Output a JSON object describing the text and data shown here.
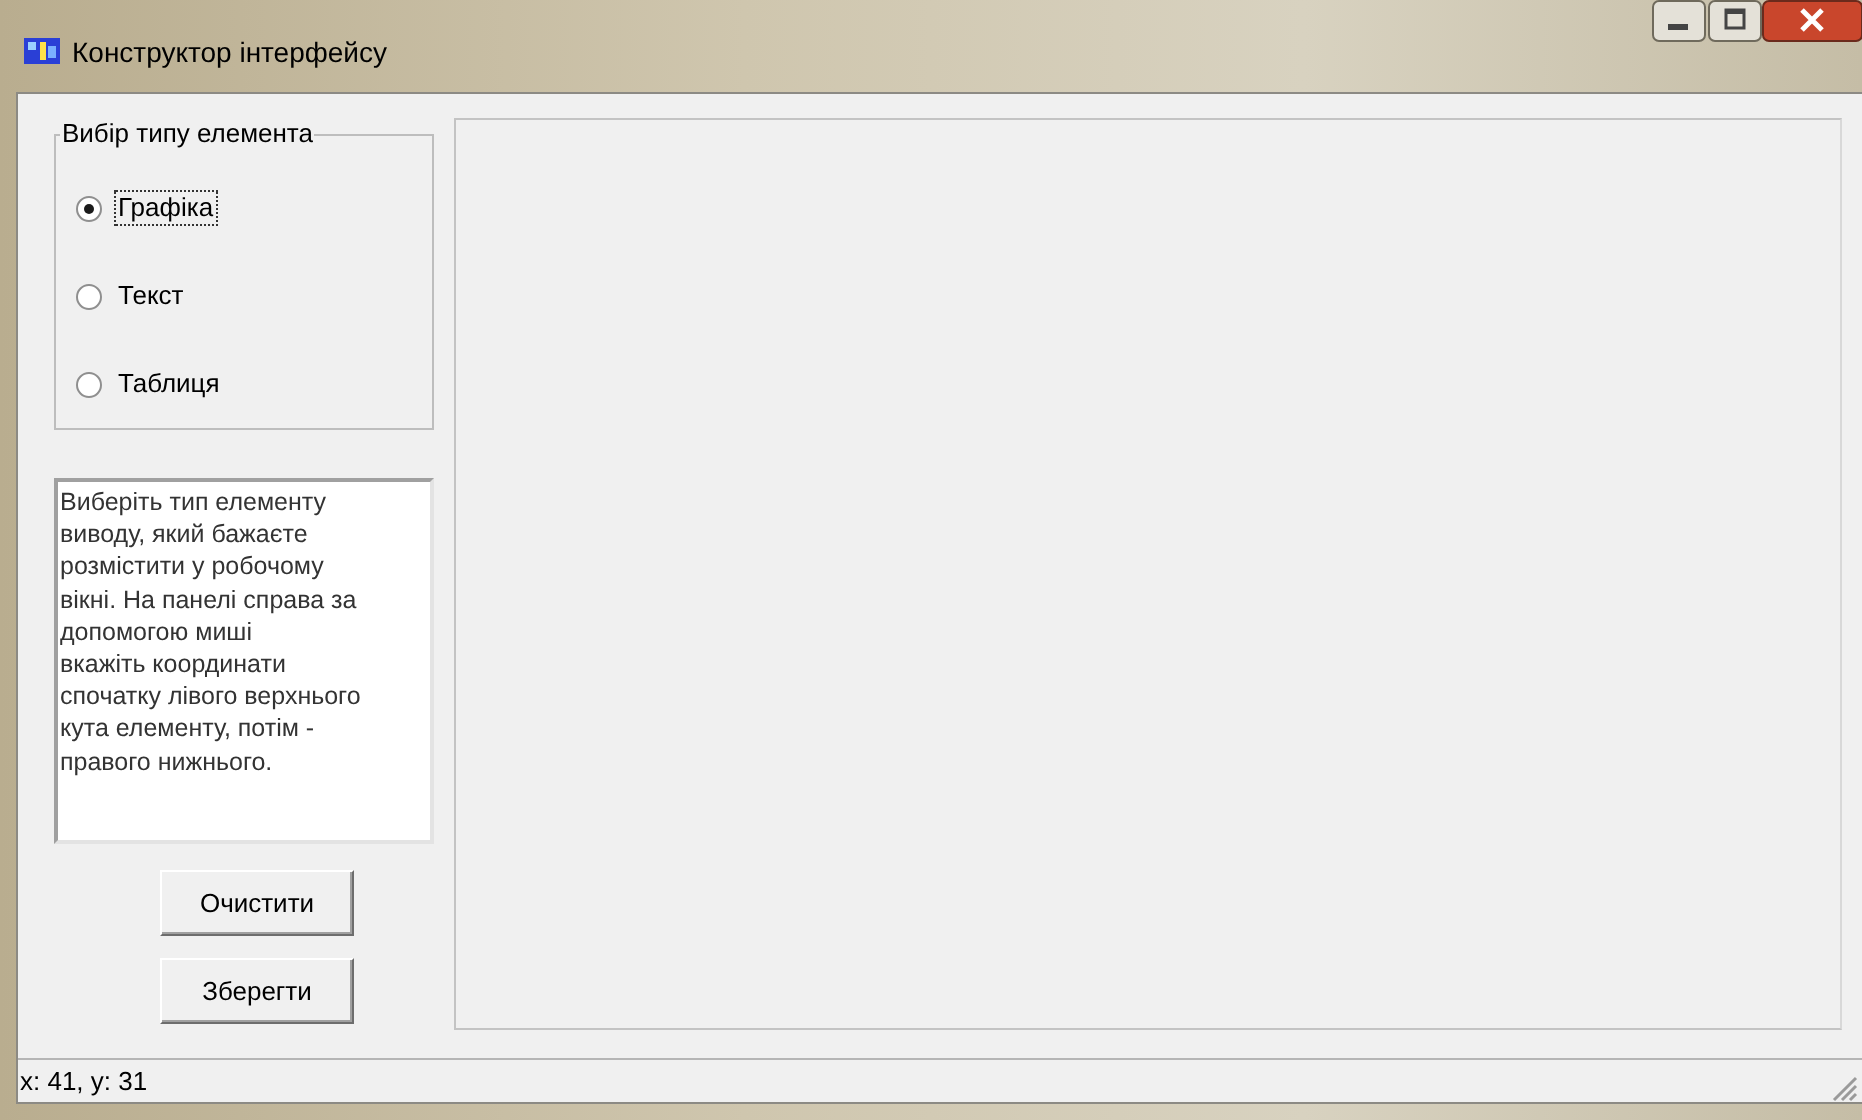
{
  "window": {
    "title": "Конструктор інтерфейсу"
  },
  "element_type_group": {
    "title": "Вибір типу елемента",
    "options": [
      {
        "label": "Графіка",
        "selected": true
      },
      {
        "label": "Текст",
        "selected": false
      },
      {
        "label": "Таблиця",
        "selected": false
      }
    ]
  },
  "instructions": "Виберіть тип елементу\nвиводу, який бажаєте\nрозмістити у робочому\nвікні. На панелі справа за\nдопомогою миші\nвкажіть координати\nспочатку лівого верхнього\nкута елементу, потім -\nправого нижнього.",
  "buttons": [
    "Очистити",
    "Зберегти"
  ],
  "status_bar": "x: 41, y: 31"
}
